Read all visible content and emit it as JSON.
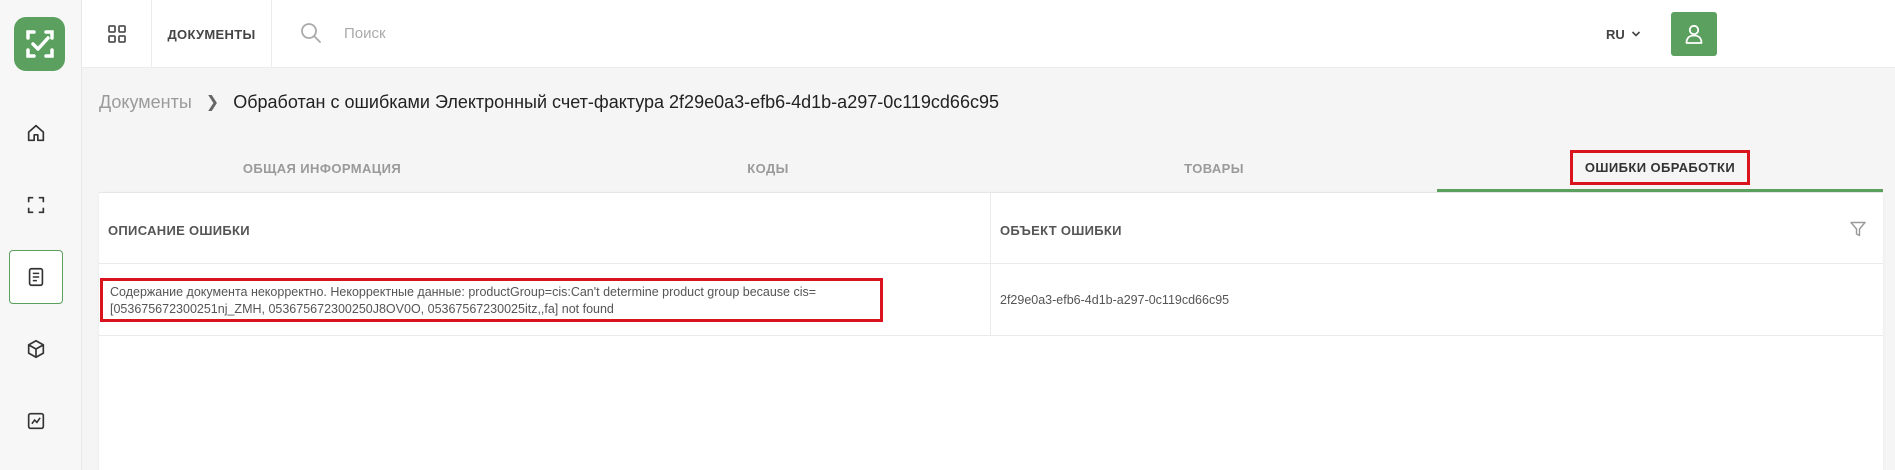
{
  "header": {
    "section_label": "ДОКУМЕНТЫ",
    "search_placeholder": "Поиск",
    "language": "RU"
  },
  "breadcrumb": {
    "root": "Документы",
    "current": "Обработан с ошибками Электронный счет-фактура 2f29e0a3-efb6-4d1b-a297-0c119cd66c95"
  },
  "tabs": [
    {
      "label": "ОБЩАЯ ИНФОРМАЦИЯ",
      "active": false
    },
    {
      "label": "КОДЫ",
      "active": false
    },
    {
      "label": "ТОВАРЫ",
      "active": false
    },
    {
      "label": "ОШИБКИ ОБРАБОТКИ",
      "active": true
    }
  ],
  "table": {
    "columns": [
      "ОПИСАНИЕ ОШИБКИ",
      "ОБЪЕКТ ОШИБКИ"
    ],
    "rows": [
      {
        "description": "Содержание документа некорректно. Некорректные данные: productGroup=cis:Can't determine product group because cis=[053675672300251nj_ZMH, 053675672300250J8OV0O, 05367567230025itz,,fa] not found",
        "object": "2f29e0a3-efb6-4d1b-a297-0c119cd66c95"
      }
    ]
  },
  "colors": {
    "accent": "#5ba05e",
    "highlight": "#d9141e"
  }
}
